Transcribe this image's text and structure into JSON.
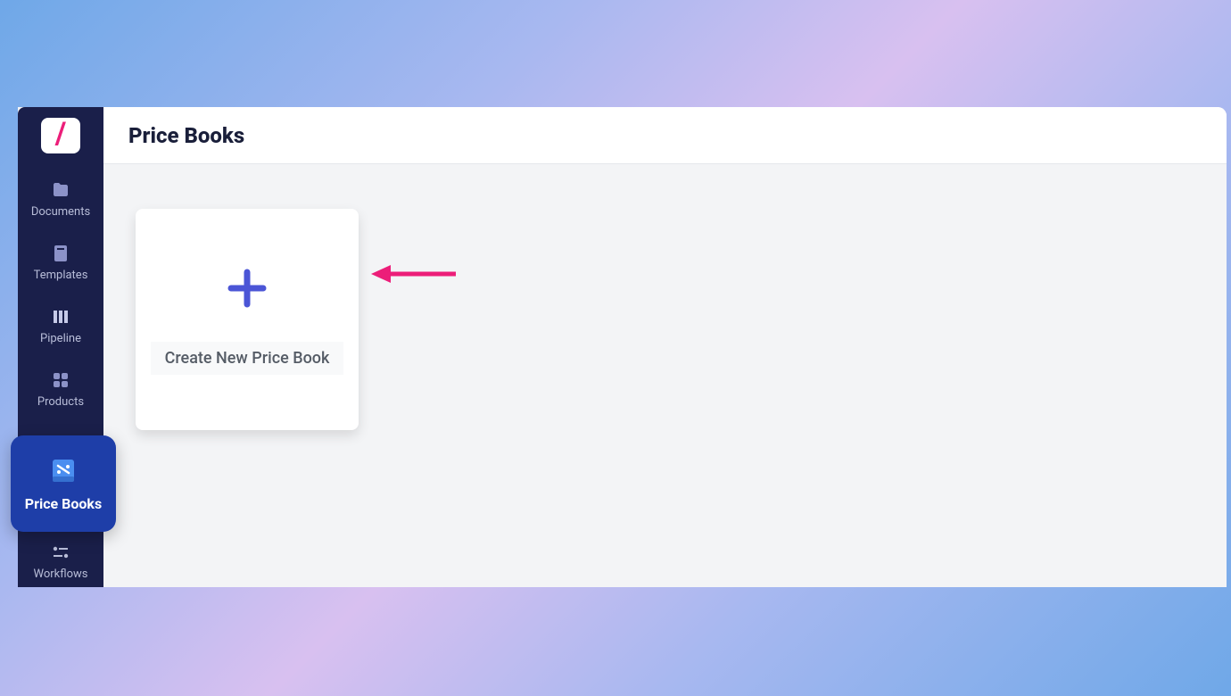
{
  "header": {
    "title": "Price Books"
  },
  "sidebar": {
    "items": [
      {
        "label": "Documents"
      },
      {
        "label": "Templates"
      },
      {
        "label": "Pipeline"
      },
      {
        "label": "Products"
      },
      {
        "label": "Price Books"
      },
      {
        "label": "Workflows"
      }
    ]
  },
  "card": {
    "create_label": "Create New Price Book"
  }
}
